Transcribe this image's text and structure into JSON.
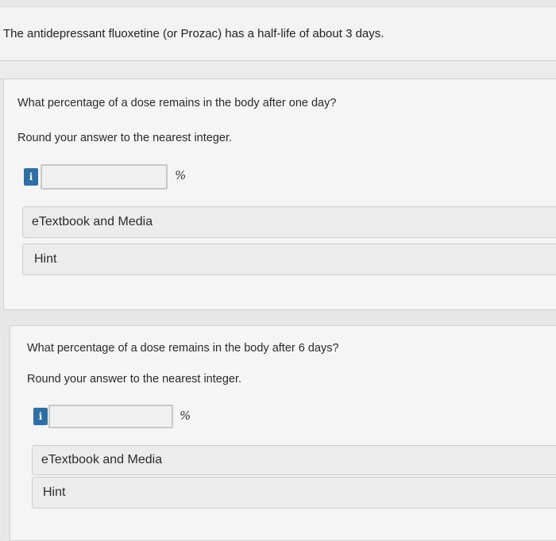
{
  "problem": {
    "statement": "The antidepressant fluoxetine (or Prozac) has a half-life of about 3 days."
  },
  "parts": [
    {
      "question": "What percentage of a dose remains in the body after one day?",
      "instruction": "Round your answer to the nearest integer.",
      "info_icon_glyph": "i",
      "answer_value": "",
      "unit": "%",
      "textbook_label": "eTextbook and Media",
      "hint_label": "Hint"
    },
    {
      "question": "What percentage of a dose remains in the body after 6 days?",
      "instruction": "Round your answer to the nearest integer.",
      "info_icon_glyph": "i",
      "answer_value": "",
      "unit": "%",
      "textbook_label": "eTextbook and Media",
      "hint_label": "Hint"
    }
  ],
  "colors": {
    "info_icon_bg": "#2f6fa8",
    "panel_bg": "#f5f5f5",
    "page_bg": "#e7e7e7"
  }
}
